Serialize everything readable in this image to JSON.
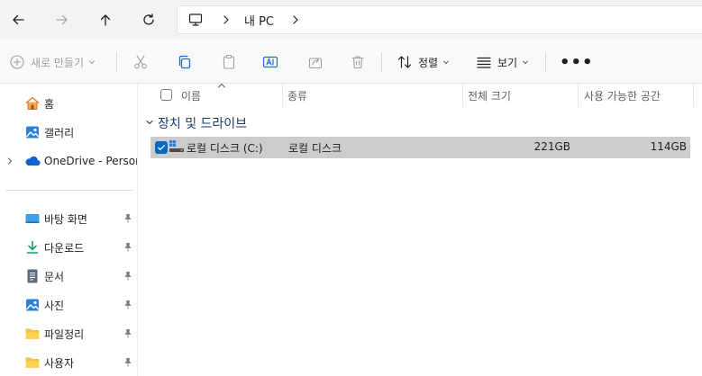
{
  "address_bar": {
    "crumb": "내 PC"
  },
  "command_bar": {
    "new_label": "새로 만들기",
    "sort_label": "정렬",
    "view_label": "보기",
    "more_label": "•••"
  },
  "sidebar": {
    "items": [
      {
        "label": "홈",
        "icon": "home-icon"
      },
      {
        "label": "갤러리",
        "icon": "gallery-icon"
      },
      {
        "label": "OneDrive - Personal",
        "icon": "onedrive-cloud-icon"
      },
      {
        "label": "바탕 화면",
        "icon": "desktop-folder-icon"
      },
      {
        "label": "다운로드",
        "icon": "download-icon"
      },
      {
        "label": "문서",
        "icon": "document-icon"
      },
      {
        "label": "사진",
        "icon": "pictures-icon"
      },
      {
        "label": "파일정리",
        "icon": "folder-icon"
      },
      {
        "label": "사용자",
        "icon": "folder-icon"
      }
    ]
  },
  "main": {
    "columns": [
      "이름",
      "종류",
      "전체 크기",
      "사용 가능한 공간"
    ],
    "group_label": "장치 및 드라이브",
    "rows": [
      {
        "name": "로컬 디스크 (C:)",
        "type": "로컬 디스크",
        "total": "221GB",
        "free": "114GB",
        "selected": true
      }
    ]
  },
  "colors": {
    "accent": "#0067c0",
    "selected_row": "#cccccc",
    "group_text": "#1a3a6e"
  }
}
